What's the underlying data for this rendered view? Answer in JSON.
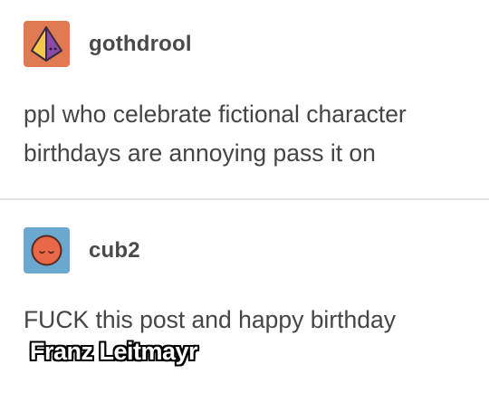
{
  "posts": [
    {
      "avatar_icon": "pyramid-avatar-icon",
      "avatar_colors": {
        "background": "#e07a52",
        "pyramid_left": "#f4c84a",
        "pyramid_right": "#8a4aa8"
      },
      "username": "gothdrool",
      "text": "ppl who celebrate fictional character birthdays are annoying pass it on"
    },
    {
      "avatar_icon": "sleeping-face-avatar-icon",
      "avatar_colors": {
        "background": "#6aa8d0",
        "face": "#e86848"
      },
      "username": "cub2",
      "text": "FUCK this post and happy birthday"
    }
  ],
  "overlay_caption": "Franz Leitmayr",
  "colors": {
    "divider": "#e2e2e2",
    "text": "#454545",
    "caption_fill": "#ffffff",
    "caption_outline": "#000000"
  }
}
